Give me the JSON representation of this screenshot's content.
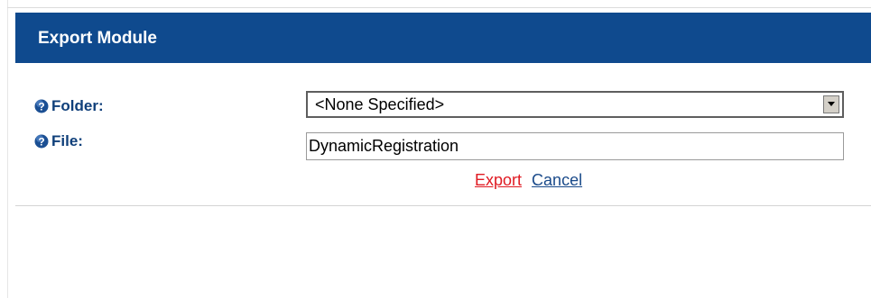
{
  "header": {
    "title": "Export Module"
  },
  "form": {
    "folder": {
      "label": "Folder:",
      "selected": "<None Specified>",
      "help_icon": "question-mark-icon"
    },
    "file": {
      "label": "File:",
      "value": "DynamicRegistration",
      "help_icon": "question-mark-icon"
    }
  },
  "actions": {
    "export_label": "Export",
    "cancel_label": "Cancel"
  },
  "colors": {
    "header_bg": "#0f4a8e",
    "label_text": "#0f3f7a",
    "export_link": "#e01a22",
    "cancel_link": "#1a4a8a"
  }
}
